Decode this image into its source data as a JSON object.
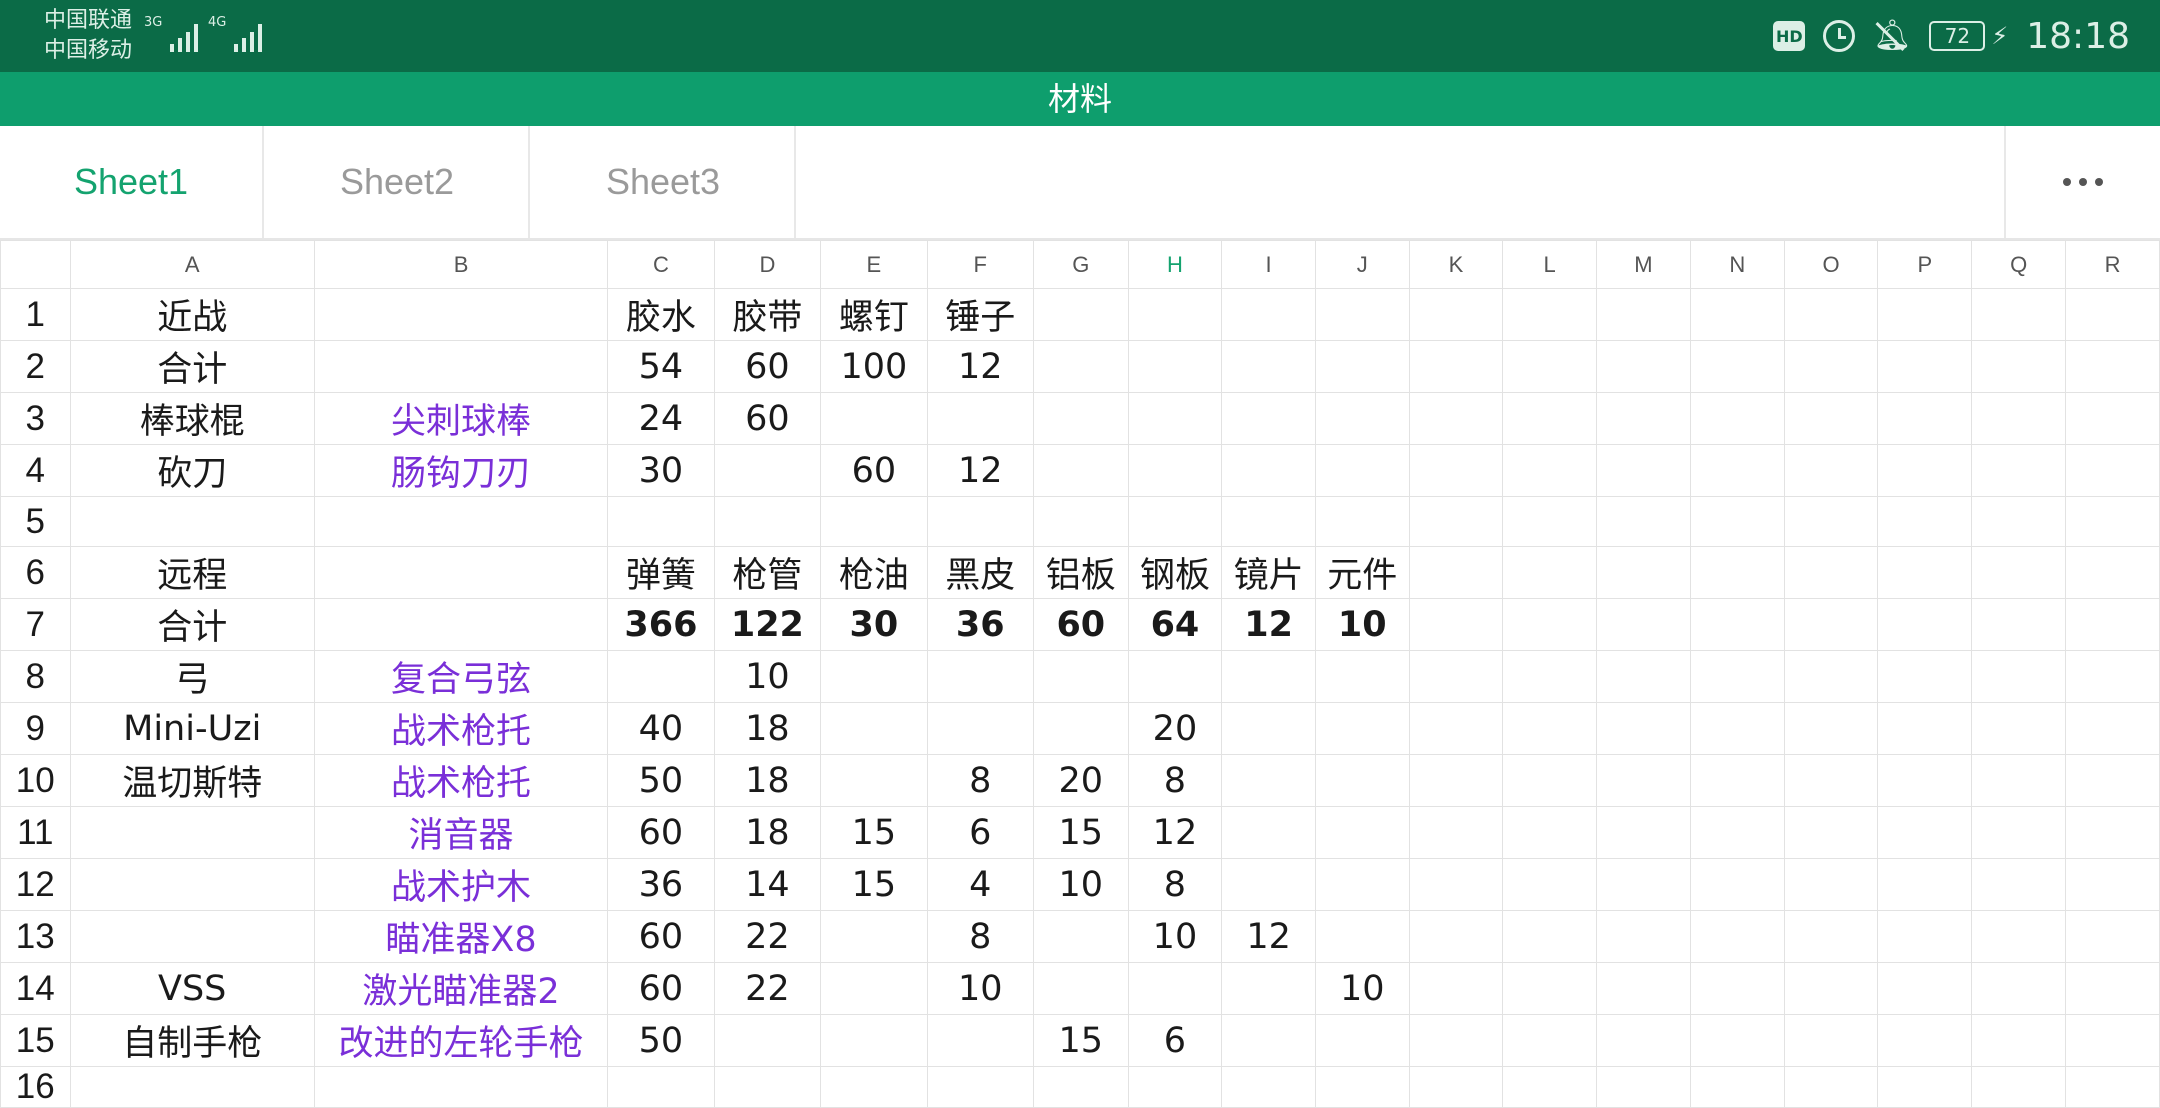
{
  "status": {
    "carrier1": "中国联通",
    "carrier2": "中国移动",
    "net1": "3G",
    "net2": "4G",
    "hd": "HD",
    "battery": "72",
    "time": "18:18"
  },
  "title": "材料",
  "tabs": [
    {
      "label": "Sheet1",
      "active": true
    },
    {
      "label": "Sheet2",
      "active": false
    },
    {
      "label": "Sheet3",
      "active": false
    }
  ],
  "columns": [
    "A",
    "B",
    "C",
    "D",
    "E",
    "F",
    "G",
    "H",
    "I",
    "J",
    "K",
    "L",
    "M",
    "N",
    "O",
    "P",
    "Q",
    "R"
  ],
  "selected_column": "H",
  "rows": [
    {
      "n": "1",
      "A": "近战",
      "B": "",
      "C": "胶水",
      "D": "胶带",
      "E": "螺钉",
      "F": "锤子",
      "G": "",
      "H": "",
      "I": "",
      "J": ""
    },
    {
      "n": "2",
      "A": "合计",
      "B": "",
      "C": "54",
      "D": "60",
      "E": "100",
      "F": "12",
      "G": "",
      "H": "",
      "I": "",
      "J": ""
    },
    {
      "n": "3",
      "A": "棒球棍",
      "B": "尖刺球棒",
      "C": "24",
      "D": "60",
      "E": "",
      "F": "",
      "G": "",
      "H": "",
      "I": "",
      "J": ""
    },
    {
      "n": "4",
      "A": "砍刀",
      "B": "肠钩刀刃",
      "C": "30",
      "D": "",
      "E": "60",
      "F": "12",
      "G": "",
      "H": "",
      "I": "",
      "J": ""
    },
    {
      "n": "5",
      "A": "",
      "B": "",
      "C": "",
      "D": "",
      "E": "",
      "F": "",
      "G": "",
      "H": "",
      "I": "",
      "J": ""
    },
    {
      "n": "6",
      "A": "远程",
      "B": "",
      "C": "弹簧",
      "D": "枪管",
      "E": "枪油",
      "F": "黑皮",
      "G": "铝板",
      "H": "钢板",
      "I": "镜片",
      "J": "元件"
    },
    {
      "n": "7",
      "A": "合计",
      "B": "",
      "C": "366",
      "D": "122",
      "E": "30",
      "F": "36",
      "G": "60",
      "H": "64",
      "I": "12",
      "J": "10"
    },
    {
      "n": "8",
      "A": "弓",
      "B": "复合弓弦",
      "C": "",
      "D": "10",
      "E": "",
      "F": "",
      "G": "",
      "H": "",
      "I": "",
      "J": ""
    },
    {
      "n": "9",
      "A": "Mini-Uzi",
      "B": "战术枪托",
      "C": "40",
      "D": "18",
      "E": "",
      "F": "",
      "G": "",
      "H": "20",
      "I": "",
      "J": ""
    },
    {
      "n": "10",
      "A": "温切斯特",
      "B": "战术枪托",
      "C": "50",
      "D": "18",
      "E": "",
      "F": "8",
      "G": "20",
      "H": "8",
      "I": "",
      "J": ""
    },
    {
      "n": "11",
      "A": "",
      "B": "消音器",
      "C": "60",
      "D": "18",
      "E": "15",
      "F": "6",
      "G": "15",
      "H": "12",
      "I": "",
      "J": ""
    },
    {
      "n": "12",
      "A": "",
      "B": "战术护木",
      "C": "36",
      "D": "14",
      "E": "15",
      "F": "4",
      "G": "10",
      "H": "8",
      "I": "",
      "J": ""
    },
    {
      "n": "13",
      "A": "",
      "B": "瞄准器X8",
      "C": "60",
      "D": "22",
      "E": "",
      "F": "8",
      "G": "",
      "H": "10",
      "I": "12",
      "J": ""
    },
    {
      "n": "14",
      "A": "VSS",
      "B": "激光瞄准器2",
      "C": "60",
      "D": "22",
      "E": "",
      "F": "10",
      "G": "",
      "H": "",
      "I": "",
      "J": "10"
    },
    {
      "n": "15",
      "A": "自制手枪",
      "B": "改进的左轮手枪",
      "C": "50",
      "D": "",
      "E": "",
      "F": "",
      "G": "15",
      "H": "6",
      "I": "",
      "J": ""
    },
    {
      "n": "16",
      "A": "",
      "B": "",
      "C": "",
      "D": "",
      "E": "",
      "F": "",
      "G": "",
      "H": "",
      "I": "",
      "J": ""
    }
  ],
  "colors": {
    "status_bg": "#0b6b47",
    "title_bg": "#0e9e6d",
    "accent": "#14a36f",
    "link_purple": "#7a2fd8"
  }
}
